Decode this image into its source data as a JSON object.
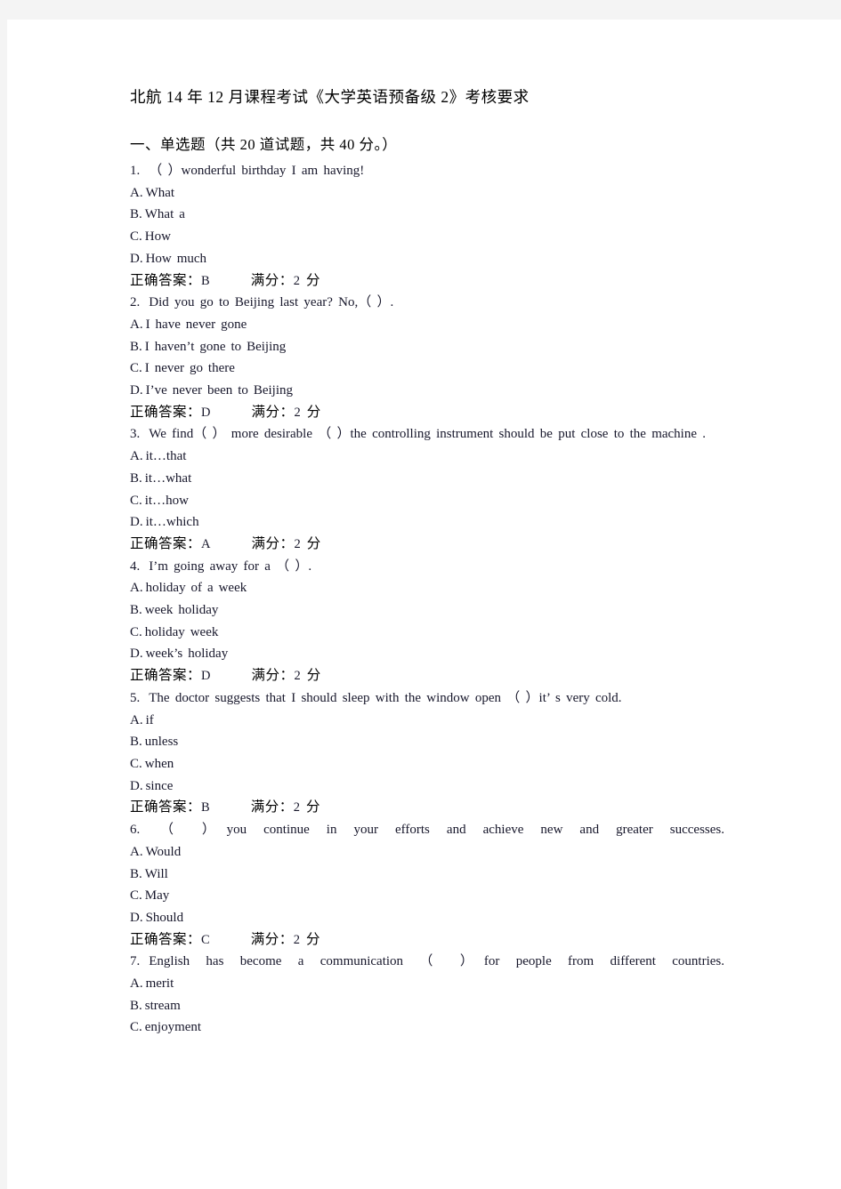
{
  "document": {
    "title": "北航 14 年 12 月课程考试《大学英语预备级 2》考核要求",
    "section_heading": "一、单选题（共 20 道试题，共 40 分。）",
    "answer_label": "正确答案：",
    "score_label": "满分：",
    "score_unit": "分",
    "questions": [
      {
        "number": "1.",
        "stem": "（ ）wonderful birthday I am having!",
        "options": [
          {
            "label": "A.",
            "text": "What"
          },
          {
            "label": "B.",
            "text": "What a"
          },
          {
            "label": "C.",
            "text": "How"
          },
          {
            "label": "D.",
            "text": "How much"
          }
        ],
        "answer": "B",
        "score": "2"
      },
      {
        "number": "2.",
        "stem": "Did you go to Beijing last year? No,（ ）.",
        "options": [
          {
            "label": "A.",
            "text": "I have never gone"
          },
          {
            "label": "B.",
            "text": "I haven’t gone to Beijing"
          },
          {
            "label": "C.",
            "text": "I never go there"
          },
          {
            "label": "D.",
            "text": "I’ve never been to Beijing"
          }
        ],
        "answer": "D",
        "score": "2"
      },
      {
        "number": "3.",
        "stem": "We find（ ） more desirable （ ）the controlling instrument should be put close to the machine .",
        "options": [
          {
            "label": "A.",
            "text": "it…that"
          },
          {
            "label": "B.",
            "text": "it…what"
          },
          {
            "label": "C.",
            "text": "it…how"
          },
          {
            "label": "D.",
            "text": "it…which"
          }
        ],
        "answer": "A",
        "score": "2"
      },
      {
        "number": "4.",
        "stem": "I’m going away for a （ ）.",
        "options": [
          {
            "label": "A.",
            "text": "holiday of a week"
          },
          {
            "label": "B.",
            "text": "week holiday"
          },
          {
            "label": "C.",
            "text": "holiday week"
          },
          {
            "label": "D.",
            "text": "week’s holiday"
          }
        ],
        "answer": "D",
        "score": "2"
      },
      {
        "number": "5.",
        "stem": "The doctor suggests that I should sleep with the window open （ ）it’ s very cold.",
        "options": [
          {
            "label": "A.",
            "text": "if"
          },
          {
            "label": "B.",
            "text": "unless"
          },
          {
            "label": "C.",
            "text": "when"
          },
          {
            "label": "D.",
            "text": "since"
          }
        ],
        "answer": "B",
        "score": "2"
      },
      {
        "number": "6.",
        "stem": "（ ）you continue in your efforts and achieve new and greater successes.",
        "options": [
          {
            "label": "A.",
            "text": "Would"
          },
          {
            "label": "B.",
            "text": "Will"
          },
          {
            "label": "C.",
            "text": "May"
          },
          {
            "label": "D.",
            "text": "Should"
          }
        ],
        "answer": "C",
        "score": "2"
      },
      {
        "number": "7.",
        "stem": "English has become a communication （ ）for people from different countries.",
        "options": [
          {
            "label": "A.",
            "text": "merit"
          },
          {
            "label": "B.",
            "text": "stream"
          },
          {
            "label": "C.",
            "text": "enjoyment"
          }
        ],
        "answer": null,
        "score": null
      }
    ]
  }
}
